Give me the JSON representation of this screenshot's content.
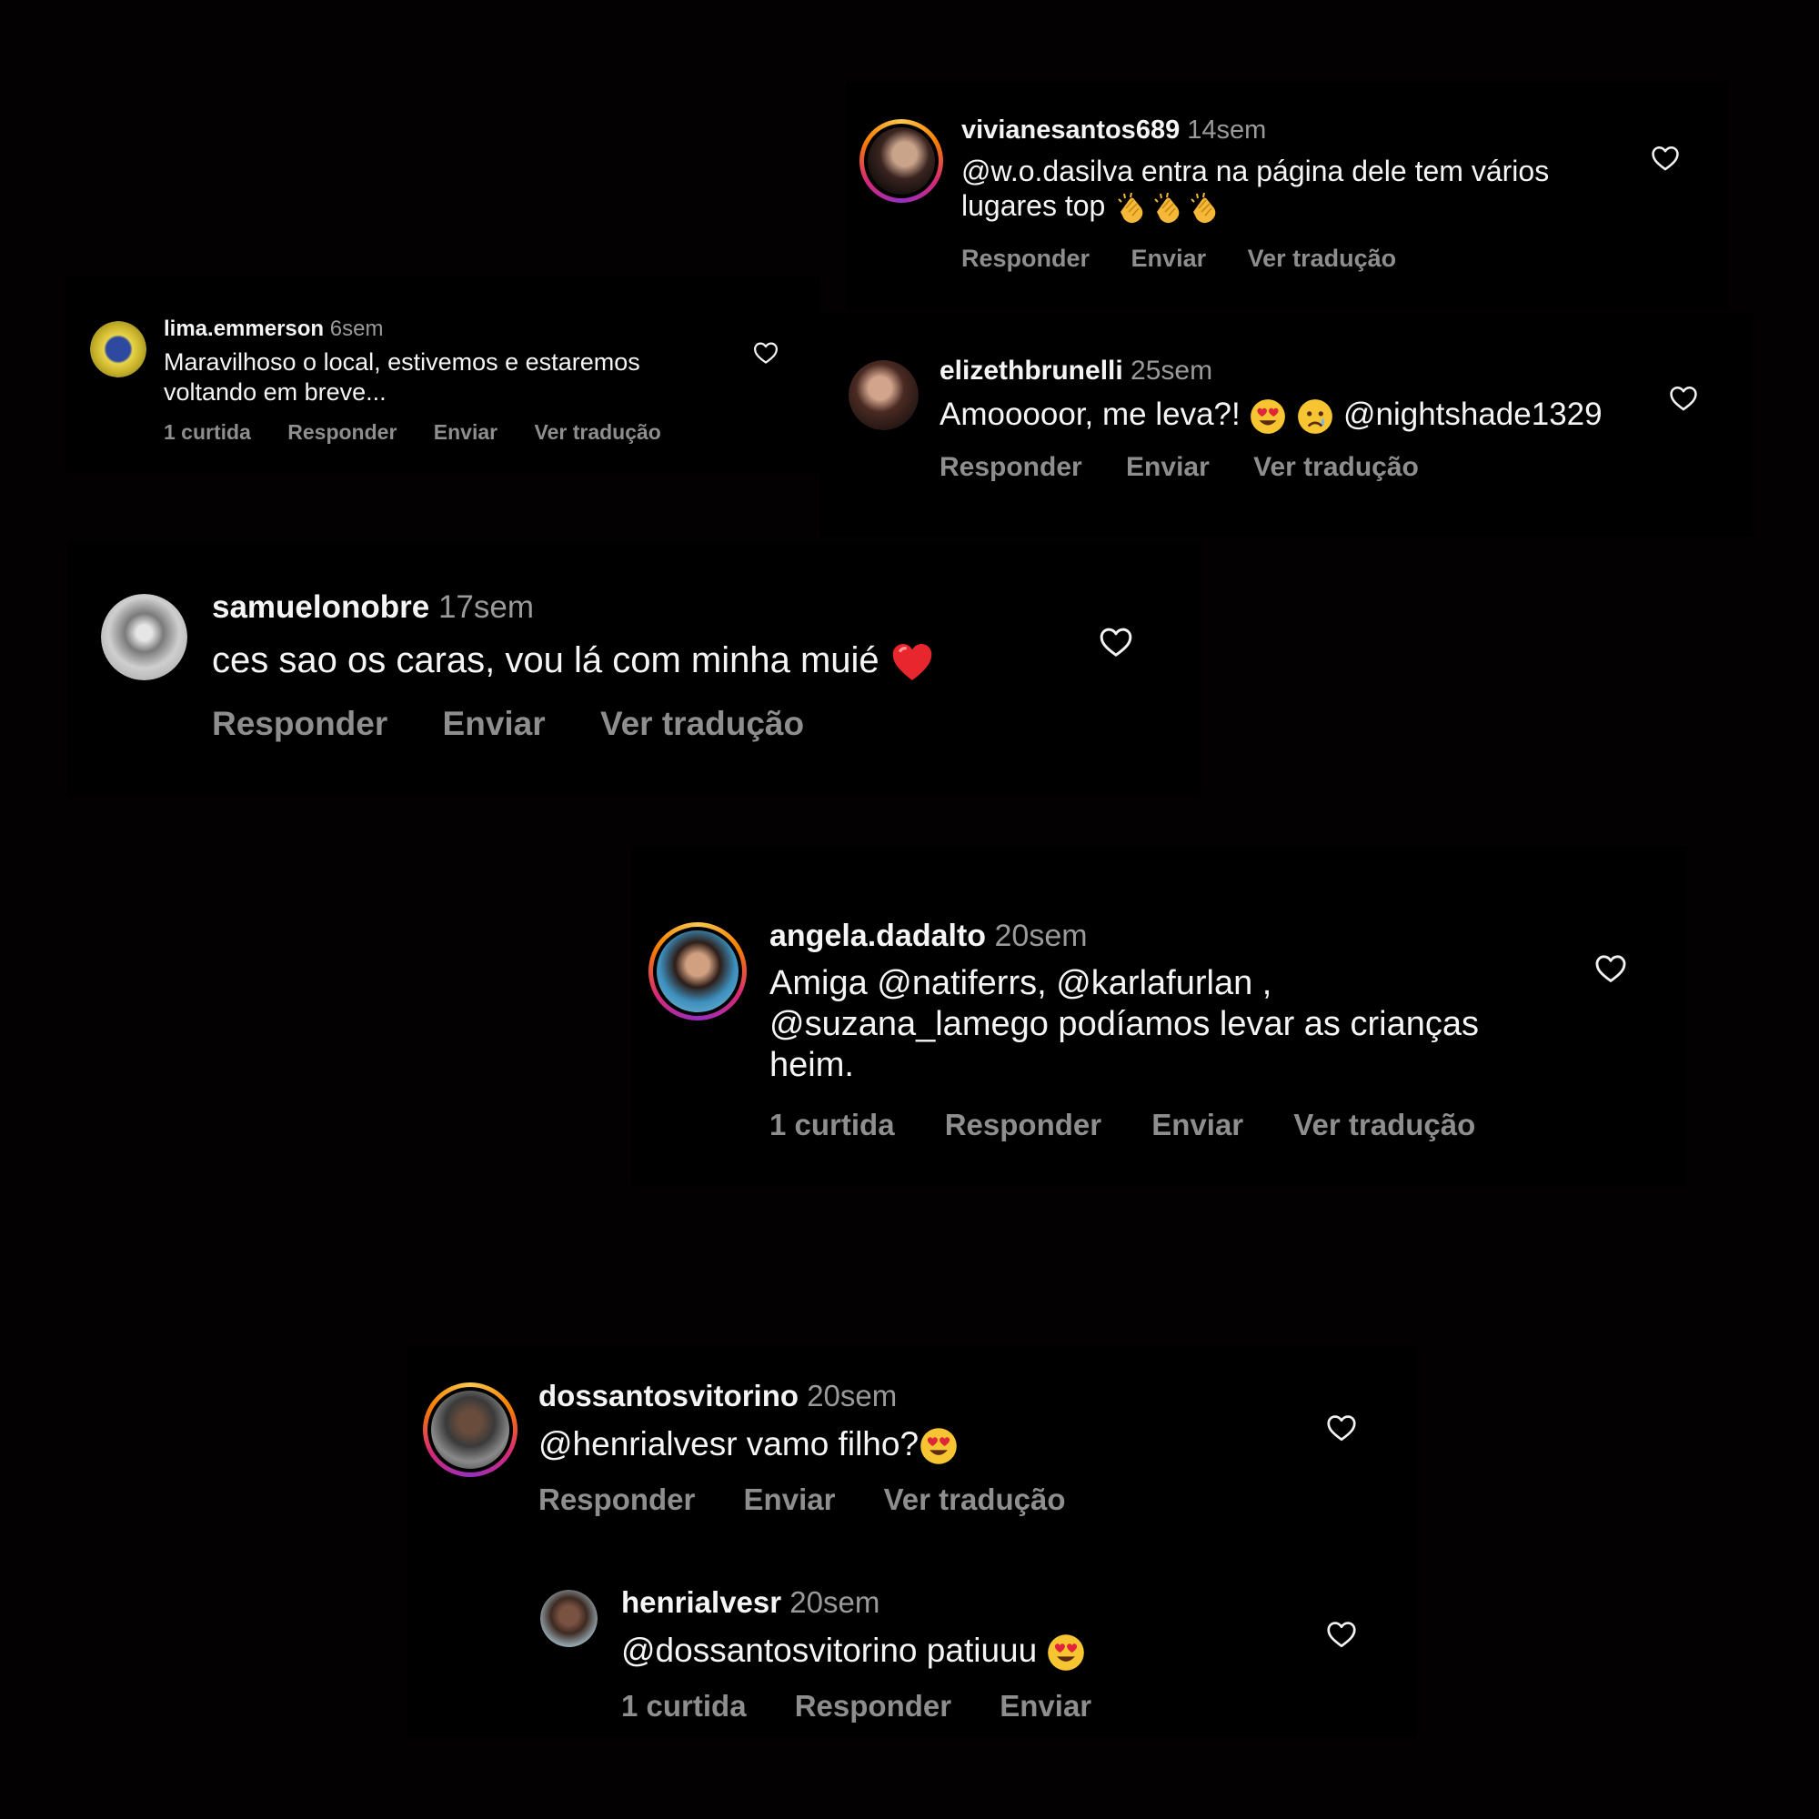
{
  "comments": [
    {
      "user": "vivianesantos689",
      "time": "14sem",
      "text": "@w.o.dasilva entra na página dele tem vários lugares top",
      "actions": [
        "Responder",
        "Enviar",
        "Ver tradução"
      ]
    },
    {
      "user": "lima.emmerson",
      "time": "6sem",
      "text_line1": "Maravilhoso o local, estivemos e estaremos",
      "text_line2": "voltando em breve...",
      "actions": [
        "1 curtida",
        "Responder",
        "Enviar",
        "Ver tradução"
      ]
    },
    {
      "user": "elizethbrunelli",
      "time": "25sem",
      "text_pre": "Amooooor, me leva?!",
      "text_post": "@nightshade1329",
      "actions": [
        "Responder",
        "Enviar",
        "Ver tradução"
      ]
    },
    {
      "user": "samuelonobre",
      "time": "17sem",
      "text": "ces sao os caras, vou lá com minha muié",
      "actions": [
        "Responder",
        "Enviar",
        "Ver tradução"
      ]
    },
    {
      "user": "angela.dadalto",
      "time": "20sem",
      "text_line1": "Amiga @natiferrs, @karlafurlan ,",
      "text_line2": "@suzana_lamego podíamos levar as crianças",
      "text_line3": "heim.",
      "actions": [
        "1 curtida",
        "Responder",
        "Enviar",
        "Ver tradução"
      ]
    },
    {
      "user": "dossantosvitorino",
      "time": "20sem",
      "text": "@henrialvesr vamo filho?",
      "actions": [
        "Responder",
        "Enviar",
        "Ver tradução"
      ]
    },
    {
      "user": "henrialvesr",
      "time": "20sem",
      "text": "@dossantosvitorino patiuuu",
      "actions": [
        "1 curtida",
        "Responder",
        "Enviar"
      ]
    }
  ],
  "icons": {
    "like": "heart-outline-icon",
    "emoji_clap": "clapping-hands",
    "emoji_love": "heart-eyes",
    "emoji_cry": "crying-face",
    "emoji_heart": "red-heart"
  },
  "colors": {
    "background": "#030102",
    "card": "#000000",
    "text": "#f5f5f5",
    "muted": "#8e8e8e",
    "story_ring_start": "#f9c74f",
    "story_ring_end": "#962fbf"
  }
}
